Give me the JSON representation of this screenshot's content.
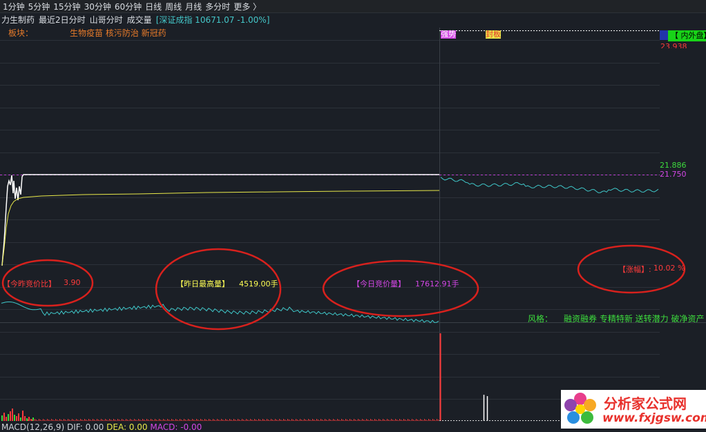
{
  "tabs": [
    "1分钟",
    "5分钟",
    "15分钟",
    "30分钟",
    "60分钟",
    "日线",
    "周线",
    "月线",
    "多分时",
    "更多 〉"
  ],
  "subbar": {
    "stock_name": "力生制药",
    "items": [
      "最近2日分时",
      "山哥分时",
      "成交量"
    ],
    "index_text": "[深证成指 10671.07 -1.00%]"
  },
  "sector": {
    "label": "板块：",
    "values": "生物疫苗 核污防治 新冠药"
  },
  "prices": {
    "top_partial": "23.938",
    "high": "21.886",
    "ref": "21.750"
  },
  "chips": {
    "strong": "强势",
    "sealed": "封板"
  },
  "side_badge": "【 内外盘】",
  "annotations": {
    "ratio_label": "【今昨竞价比】",
    "ratio_value": "3.90",
    "yest_label": "【昨日最高量】",
    "yest_value": "4519.00手",
    "today_label": "【今日竞价量】",
    "today_value": "17612.91手",
    "rise_label": "【涨幅】:",
    "rise_value": "10.02 %"
  },
  "style": {
    "label": "风格：",
    "values": "融资融券 专精特新 送转潜力 破净资产"
  },
  "macd": {
    "title": "MACD(12,26,9)",
    "dif": "DIF: 0.00",
    "dea": "DEA: 0.00",
    "macd": "MACD: -0.00"
  },
  "logo": {
    "cn": "分析家公式网",
    "url": "www.fxjgsw.com"
  },
  "colors": {
    "background": "#1b1f26",
    "grid": "#2c3139",
    "price_line": "#ffffff",
    "avg_line": "#e8e84a",
    "cyan_line": "#3fc7c9",
    "reference_dashed": "#c03fd6",
    "volume_up": "#ff3b3b",
    "circle": "#d8211d"
  }
}
